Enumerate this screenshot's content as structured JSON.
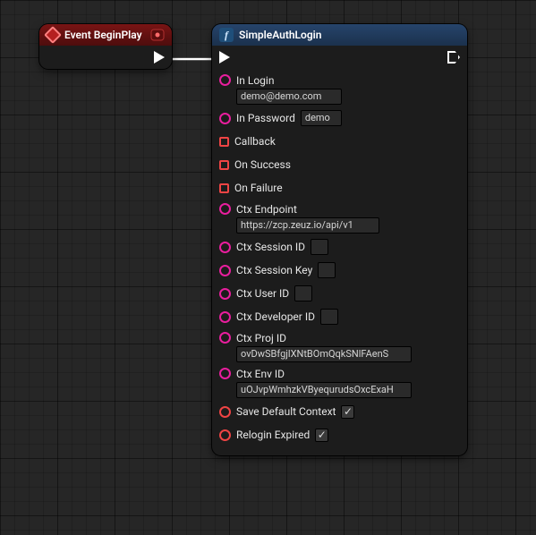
{
  "eventNode": {
    "title": "Event BeginPlay"
  },
  "funcNode": {
    "title": "SimpleAuthLogin",
    "pins": {
      "inLogin": {
        "label": "In Login",
        "value": "demo@demo.com"
      },
      "inPassword": {
        "label": "In Password",
        "value": "demo"
      },
      "callback": {
        "label": "Callback"
      },
      "onSuccess": {
        "label": "On Success"
      },
      "onFailure": {
        "label": "On Failure"
      },
      "ctxEndpoint": {
        "label": "Ctx Endpoint",
        "value": "https://zcp.zeuz.io/api/v1"
      },
      "ctxSessionId": {
        "label": "Ctx Session ID",
        "value": ""
      },
      "ctxSessionKey": {
        "label": "Ctx Session Key",
        "value": ""
      },
      "ctxUserId": {
        "label": "Ctx User ID",
        "value": ""
      },
      "ctxDevId": {
        "label": "Ctx Developer ID",
        "value": ""
      },
      "ctxProjId": {
        "label": "Ctx Proj ID",
        "value": "ovDwSBfgjlXNtBOmQqkSNlFAenS"
      },
      "ctxEnvId": {
        "label": "Ctx Env ID",
        "value": "uOJvpWmhzkVByequrudsOxcExaH"
      },
      "saveDefault": {
        "label": "Save Default Context",
        "checked": true
      },
      "reloginExpired": {
        "label": "Relogin Expired",
        "checked": true
      }
    }
  }
}
